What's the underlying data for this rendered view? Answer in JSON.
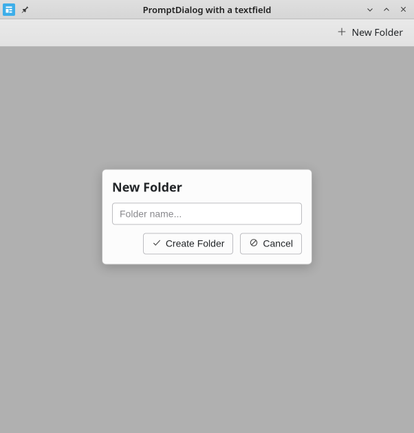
{
  "window": {
    "title": "PromptDialog with a textfield"
  },
  "toolbar": {
    "new_folder_label": "New Folder"
  },
  "dialog": {
    "title": "New Folder",
    "input_value": "",
    "input_placeholder": "Folder name...",
    "create_label": "Create Folder",
    "cancel_label": "Cancel"
  }
}
